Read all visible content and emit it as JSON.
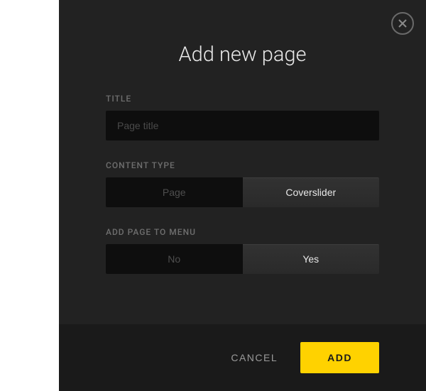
{
  "modal": {
    "title": "Add new page",
    "fields": {
      "title": {
        "label": "TITLE",
        "placeholder": "Page title",
        "value": ""
      },
      "contentType": {
        "label": "CONTENT TYPE",
        "options": {
          "page": "Page",
          "coverslider": "Coverslider"
        },
        "selected": "coverslider"
      },
      "addToMenu": {
        "label": "ADD PAGE TO MENU",
        "options": {
          "no": "No",
          "yes": "Yes"
        },
        "selected": "yes"
      }
    },
    "actions": {
      "cancel": "CANCEL",
      "add": "ADD"
    }
  }
}
